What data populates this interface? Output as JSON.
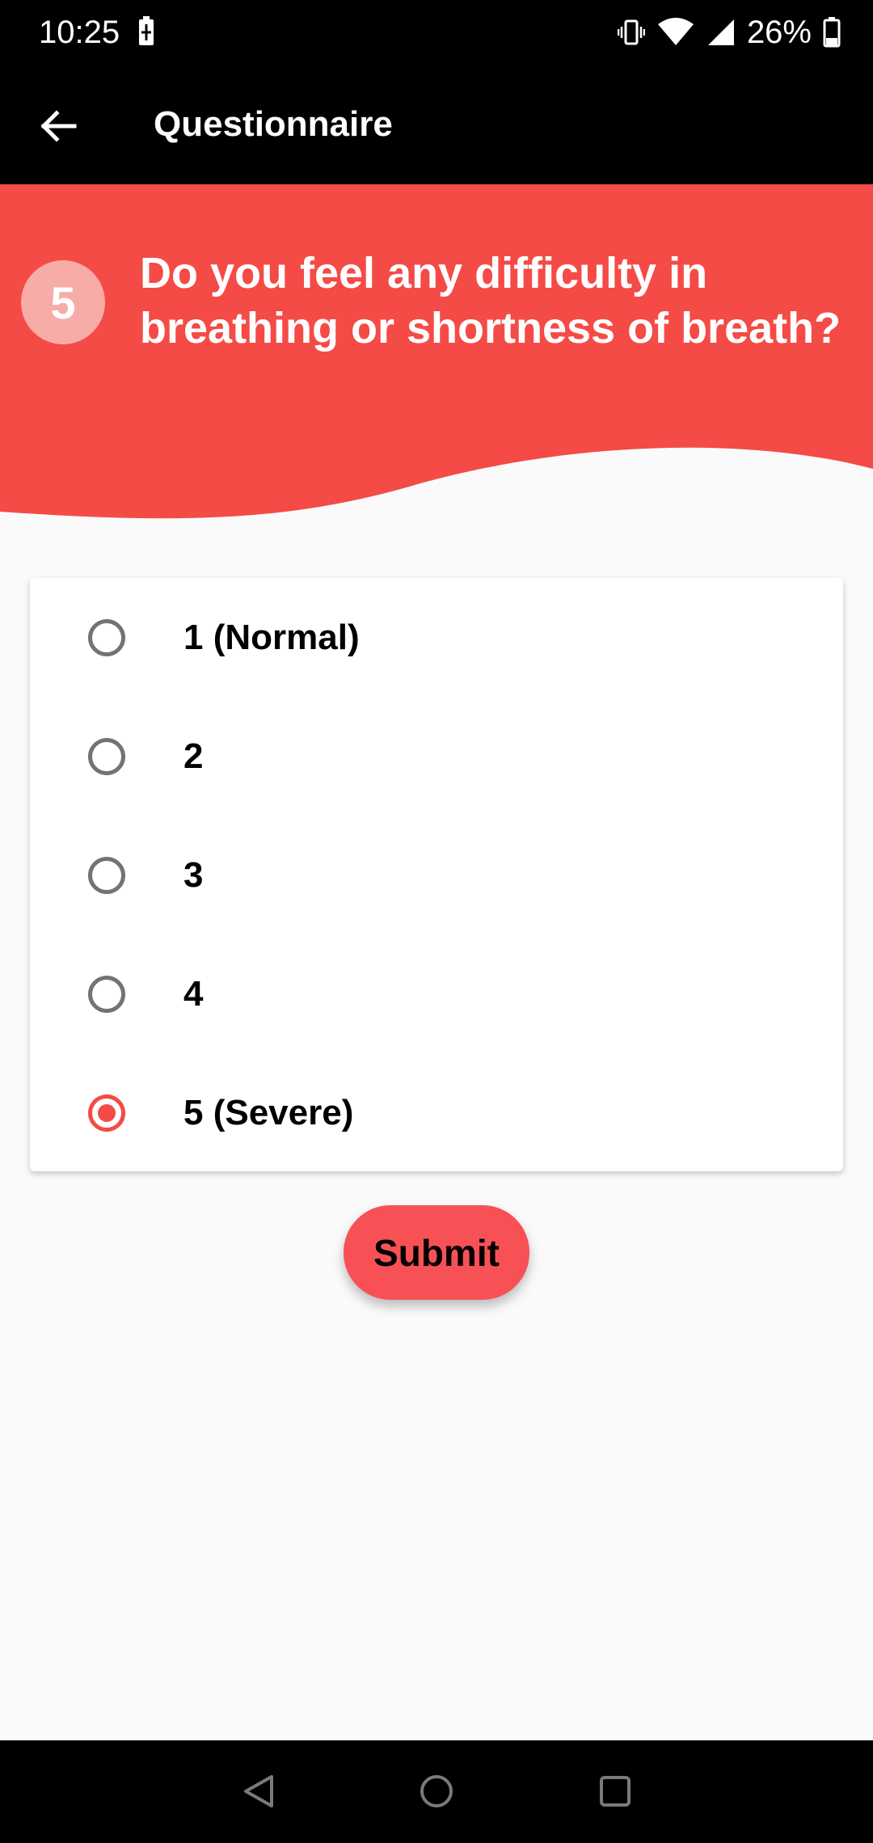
{
  "status_bar": {
    "time": "10:25",
    "battery_percent": "26%",
    "icons": [
      "battery-charging-icon",
      "vibrate-icon",
      "wifi-icon",
      "signal-icon",
      "battery-icon"
    ]
  },
  "app_bar": {
    "title": "Questionnaire",
    "back_icon": "arrow-left-icon"
  },
  "question": {
    "number": "5",
    "text": "Do you feel any difficulty in breathing or shortness of breath?"
  },
  "options": [
    {
      "label": "1 (Normal)",
      "checked": false
    },
    {
      "label": "2",
      "checked": false
    },
    {
      "label": "3",
      "checked": false
    },
    {
      "label": "4",
      "checked": false
    },
    {
      "label": "5 (Severe)",
      "checked": true
    }
  ],
  "submit": {
    "label": "Submit"
  },
  "nav_bar": {
    "icons": [
      "back-triangle-icon",
      "home-circle-icon",
      "recents-square-icon"
    ]
  },
  "colors": {
    "accent": "#f44b47",
    "badge": "#f8aca7",
    "submit": "#f75156",
    "background": "#fafafa"
  }
}
